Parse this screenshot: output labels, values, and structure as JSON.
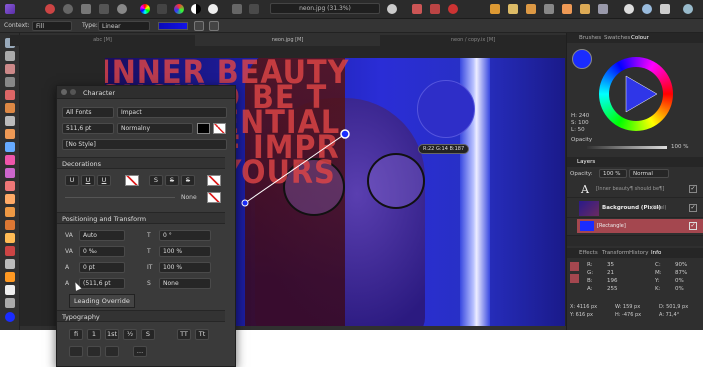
{
  "context": {
    "label": "Context:",
    "context_value": "Fill",
    "type_label": "Type:",
    "type_value": "Linear"
  },
  "title": {
    "doc_name": "neon.jpg (31.3%)"
  },
  "doc_tabs": [
    "abc [M]",
    "neon.jpg [M]",
    "neon / copy.ix [M]"
  ],
  "character": {
    "title": "Character",
    "font_collection": "All Fonts",
    "font_name": "Impact",
    "font_size": "511,6 pt",
    "font_style": "Normalny",
    "style": "[No Style]",
    "decorations": {
      "title": "Decorations",
      "buttons": [
        "U",
        "U",
        "U",
        "S",
        "S",
        "S"
      ],
      "line_value": "None"
    },
    "positioning": {
      "title": "Positioning and Transform",
      "tracking": "Auto",
      "kerning": "0 ‰",
      "baseline": "0 pt",
      "leading": "(511,6 pt",
      "shear": "0 °",
      "width": "100 %",
      "height": "100 %",
      "alignment": "None"
    },
    "tooltip": "Leading Override",
    "typography": {
      "title": "Typography",
      "buttons": [
        "fi",
        "1",
        "1st",
        "½",
        "S",
        "TT",
        "Tt",
        "…"
      ]
    }
  },
  "colour_panel": {
    "tabs": [
      "Brushes",
      "Swatches",
      "Colour"
    ],
    "hue": "H: 240",
    "sat": "S: 100",
    "light": "L: 50",
    "opacity_label": "Opacity",
    "opacity": "100 %"
  },
  "layers": {
    "title": "Layers",
    "opacity_label": "Opacity:",
    "opacity": "100 %",
    "blend": "Normal",
    "rows": [
      "[Inner beauty¶ should be¶]",
      "Background (Pixel)",
      "[Rectangle]"
    ],
    "row_types": [
      "(Artistic Text)",
      "(Pixel)",
      ""
    ]
  },
  "info": {
    "tabs": [
      "Effects",
      "Transform",
      "History",
      "Info"
    ],
    "r": "35",
    "g": "21",
    "b": "196",
    "a": "255",
    "c": "90%",
    "m": "87%",
    "y": "0%",
    "k": "0%",
    "x": "X: 4116 px",
    "w": "W: 159 px",
    "d": "D: 501,9 px",
    "yv": "Y: 616 px",
    "h": "H: -476 px",
    "ang": "A: 71,4°"
  },
  "sampler": {
    "readout": "R:22 G:14 B:187"
  },
  "canvas_text": "INNER BEAUTY SHOULD BE THE ESSENTIAL PART OF IMPROVING YOURSELF"
}
